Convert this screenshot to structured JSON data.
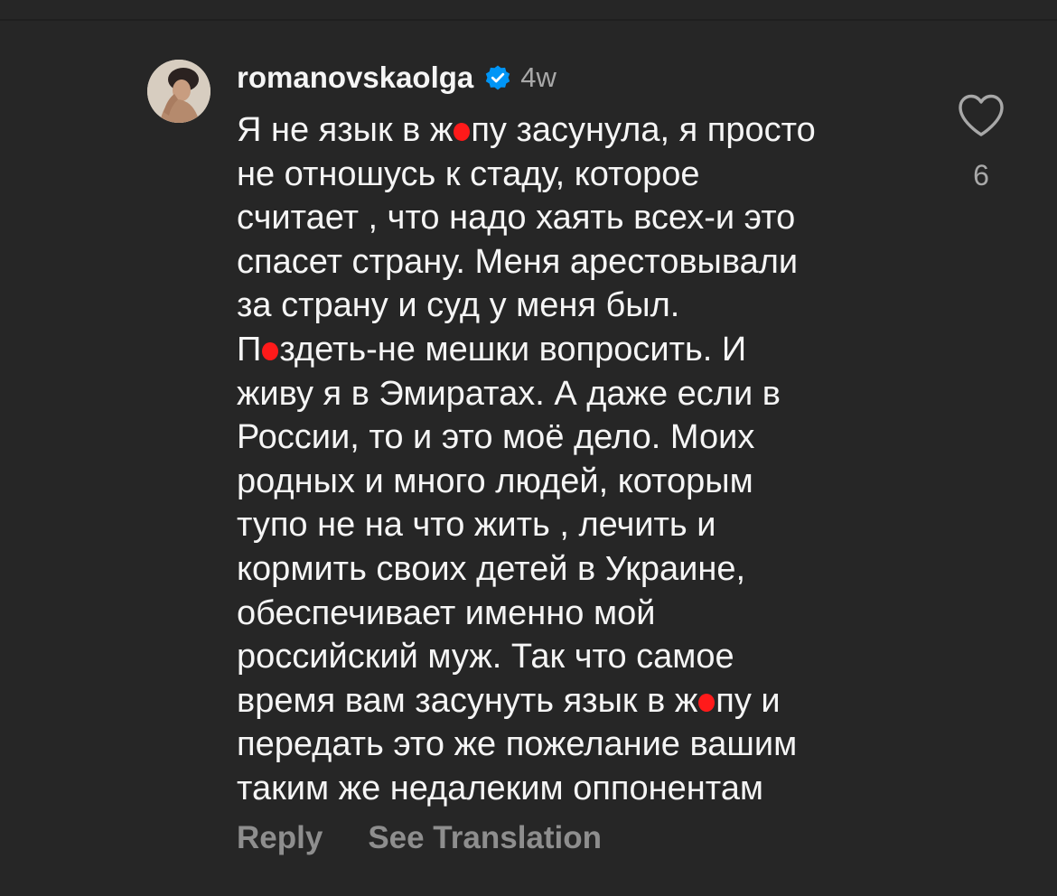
{
  "comment": {
    "username": "romanovskaolga",
    "timestamp": "4w",
    "lines": [
      "Я не язык в ж[censored]пу засунула, я просто",
      "не отношусь к стаду, которое",
      "считает , что надо хаять всех-и это",
      "спасет страну. Меня арестовывали",
      "за страну и суд у меня был.",
      "П[censored]здеть-не мешки вопросить. И",
      "живу я в Эмиратах. А даже если в",
      "России, то и это моё дело. Моих",
      "родных и много людей, которым",
      "тупо не на что жить , лечить и",
      "кормить своих детей в Украине,",
      "обеспечивает именно мой",
      "российский муж. Так что самое",
      "время вам засунуть язык в ж[censored]пу и",
      "передать это же пожелание вашим",
      "таким же недалеким оппонентам"
    ],
    "like_count": "6",
    "reply_label": "Reply",
    "translate_label": "See Translation"
  },
  "icons": {
    "verified": "verified-badge-icon",
    "like": "heart-outline-icon",
    "censor": "red-censor-mark"
  },
  "colors": {
    "background": "#262626",
    "text_primary": "#f5f5f5",
    "text_secondary": "#a8a8a8",
    "verified_blue": "#0095f6",
    "censor_red": "#ff1a1a"
  }
}
